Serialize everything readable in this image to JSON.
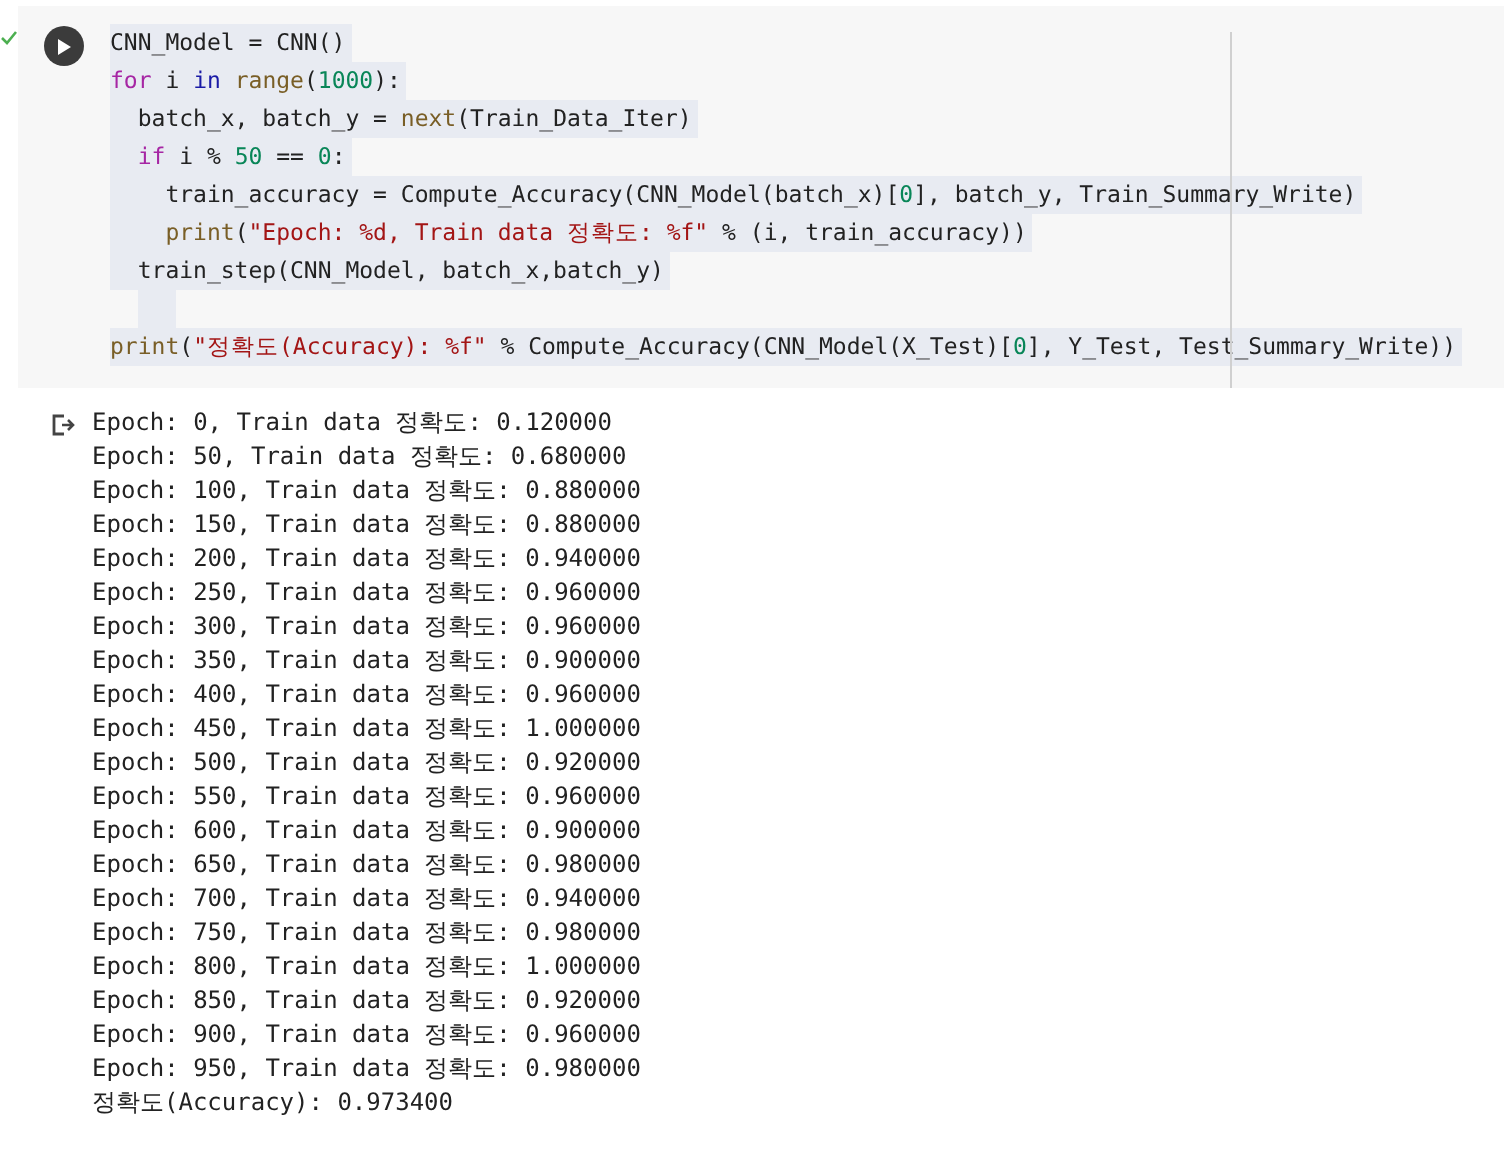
{
  "code_cell": {
    "executed": true,
    "lines": [
      [
        {
          "kind": "plain",
          "text": "CNN_Model = CNN()"
        }
      ],
      [
        {
          "kind": "keyword",
          "text": "for"
        },
        {
          "kind": "plain",
          "text": " i "
        },
        {
          "kind": "keyword2",
          "text": "in "
        },
        {
          "kind": "builtin",
          "text": "range"
        },
        {
          "kind": "plain",
          "text": "("
        },
        {
          "kind": "number",
          "text": "1000"
        },
        {
          "kind": "plain",
          "text": "):"
        }
      ],
      [
        {
          "kind": "plain",
          "text": "  batch_x, batch_y = "
        },
        {
          "kind": "builtin",
          "text": "next"
        },
        {
          "kind": "plain",
          "text": "(Train_Data_Iter)"
        }
      ],
      [
        {
          "kind": "keyword",
          "text": "  if"
        },
        {
          "kind": "plain",
          "text": " i % "
        },
        {
          "kind": "number",
          "text": "50"
        },
        {
          "kind": "plain",
          "text": " == "
        },
        {
          "kind": "number",
          "text": "0"
        },
        {
          "kind": "plain",
          "text": ":"
        }
      ],
      [
        {
          "kind": "plain",
          "text": "    train_accuracy = Compute_Accuracy(CNN_Model(batch_x)["
        },
        {
          "kind": "number",
          "text": "0"
        },
        {
          "kind": "plain",
          "text": "], batch_y, Train_Summary_Write)"
        }
      ],
      [
        {
          "kind": "builtin",
          "text": "    print"
        },
        {
          "kind": "plain",
          "text": "("
        },
        {
          "kind": "string",
          "text": "\"Epoch: %d, Train data 정확도: %f\""
        },
        {
          "kind": "plain",
          "text": " % (i, train_accuracy))"
        }
      ],
      [
        {
          "kind": "plain",
          "text": "  train_step(CNN_Model, batch_x,batch_y)"
        }
      ],
      [
        {
          "kind": "blank"
        }
      ],
      [
        {
          "kind": "builtin",
          "text": "print"
        },
        {
          "kind": "plain",
          "text": "("
        },
        {
          "kind": "string",
          "text": "\"정확도(Accuracy): %f\""
        },
        {
          "kind": "plain",
          "text": " % Compute_Accuracy(CNN_Model(X_Test)["
        },
        {
          "kind": "number",
          "text": "0"
        },
        {
          "kind": "plain",
          "text": "], Y_Test, Test_Summary_Write))"
        }
      ]
    ]
  },
  "output": {
    "lines": [
      "Epoch: 0, Train data 정확도: 0.120000",
      "Epoch: 50, Train data 정확도: 0.680000",
      "Epoch: 100, Train data 정확도: 0.880000",
      "Epoch: 150, Train data 정확도: 0.880000",
      "Epoch: 200, Train data 정확도: 0.940000",
      "Epoch: 250, Train data 정확도: 0.960000",
      "Epoch: 300, Train data 정확도: 0.960000",
      "Epoch: 350, Train data 정확도: 0.900000",
      "Epoch: 400, Train data 정확도: 0.960000",
      "Epoch: 450, Train data 정확도: 1.000000",
      "Epoch: 500, Train data 정확도: 0.920000",
      "Epoch: 550, Train data 정확도: 0.960000",
      "Epoch: 600, Train data 정확도: 0.900000",
      "Epoch: 650, Train data 정확도: 0.980000",
      "Epoch: 700, Train data 정확도: 0.940000",
      "Epoch: 750, Train data 정확도: 0.980000",
      "Epoch: 800, Train data 정확도: 1.000000",
      "Epoch: 850, Train data 정확도: 0.920000",
      "Epoch: 900, Train data 정확도: 0.960000",
      "Epoch: 950, Train data 정확도: 0.980000",
      "정확도(Accuracy): 0.973400"
    ]
  }
}
